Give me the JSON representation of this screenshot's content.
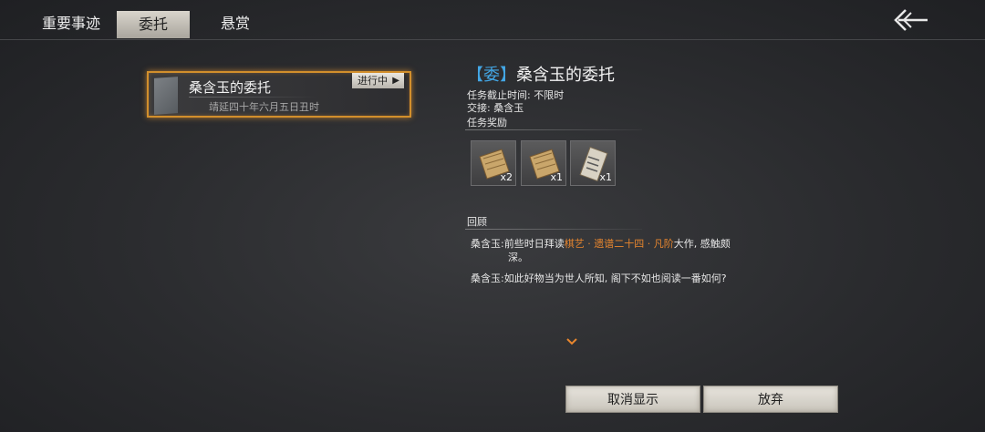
{
  "tabs": [
    {
      "label": "重要事迹"
    },
    {
      "label": "委托"
    },
    {
      "label": "悬赏"
    }
  ],
  "quest_list": [
    {
      "title": "桑含玉的委托",
      "status": "进行中",
      "date": "靖延四十年六月五日丑时"
    }
  ],
  "detail": {
    "tag": "【委】",
    "title": "桑含玉的委托",
    "deadline": "任务截止时间: 不限时",
    "submit_to": "交接: 桑含玉",
    "rewards_label": "任务奖励",
    "rewards": [
      {
        "icon": "scroll-book-icon",
        "qty": "x2"
      },
      {
        "icon": "scroll-book-icon",
        "qty": "x1"
      },
      {
        "icon": "rolled-scroll-icon",
        "qty": "x1"
      }
    ],
    "review_label": "回顾",
    "dialogue": {
      "speaker1": "桑含玉:",
      "line1_a": "前些时日拜读",
      "line1_hl": "棋艺 · 遗谱二十四 · 凡阶",
      "line1_b": "大作, 感触颇",
      "line1_c": "深。",
      "speaker2": "桑含玉:",
      "line2": "如此好物当为世人所知, 阁下不如也阅读一番如何?"
    }
  },
  "buttons": {
    "cancel_display": "取消显示",
    "abandon": "放弃"
  },
  "colors": {
    "accent_orange": "#d28f2c",
    "highlight": "#e8862e",
    "tag_blue": "#43a7e6"
  }
}
